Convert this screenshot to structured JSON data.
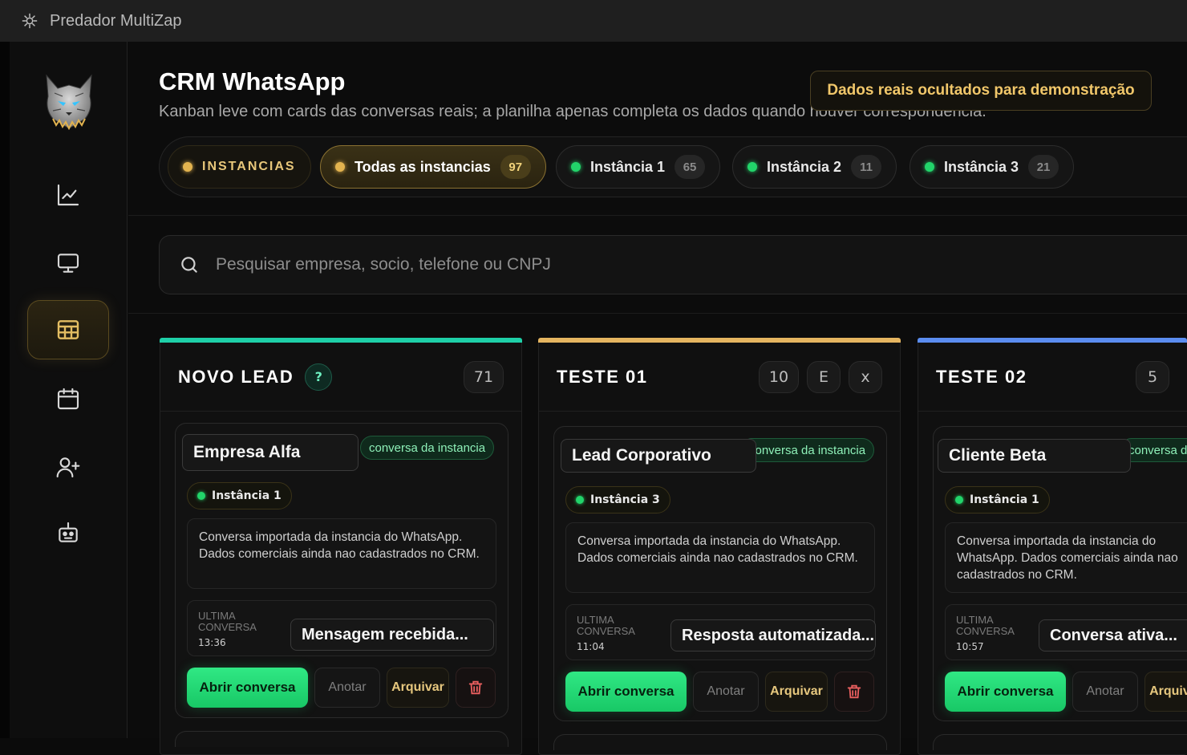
{
  "window": {
    "title": "Predador MultiZap"
  },
  "header": {
    "title": "CRM WhatsApp",
    "subtitle": "Kanban leve com cards das conversas reais; a planilha apenas completa os dados quando houver correspondência.",
    "demo_badge": "Dados reais ocultados para demonstração"
  },
  "instances": {
    "label": "INSTANCIAS",
    "chips": [
      {
        "label": "Todas as instancias",
        "count": "97"
      },
      {
        "label": "Instância 1",
        "count": "65"
      },
      {
        "label": "Instância 2",
        "count": "11"
      },
      {
        "label": "Instância 3",
        "count": "21"
      }
    ]
  },
  "search": {
    "placeholder": "Pesquisar empresa, socio, telefone ou CNPJ"
  },
  "sidebar": {
    "icons": [
      "chart-icon",
      "monitor-icon",
      "table-icon",
      "calendar-icon",
      "user-plus-icon",
      "bot-icon"
    ],
    "active": "table-icon"
  },
  "colors": {
    "accent_gold": "#e2b34f",
    "green": "#22d46a",
    "col1": "#1ed0a8",
    "col2": "#e5b560",
    "col3": "#5b8df0"
  },
  "columns": [
    {
      "title": "NOVO LEAD",
      "help": "?",
      "count": "71",
      "card": {
        "name": "Empresa Alfa",
        "tag": "conversa da instancia",
        "instance": "Instância 1",
        "description": "Conversa importada da instancia do WhatsApp. Dados comerciais ainda nao cadastrados no CRM.",
        "last_label": "ULTIMA CONVERSA",
        "last_time": "13:36",
        "last_message": "Mensagem recebida...",
        "actions": {
          "open": "Abrir conversa",
          "note": "Anotar",
          "archive": "Arquivar"
        }
      }
    },
    {
      "title": "TESTE 01",
      "count": "10",
      "edit": "E",
      "close": "x",
      "card": {
        "name": "Lead Corporativo",
        "tag": "conversa da instancia",
        "instance": "Instância 3",
        "description": "Conversa importada da instancia do WhatsApp. Dados comerciais ainda nao cadastrados no CRM.",
        "last_label": "ULTIMA CONVERSA",
        "last_time": "11:04",
        "last_message": "Resposta automatizada...",
        "actions": {
          "open": "Abrir conversa",
          "note": "Anotar",
          "archive": "Arquivar"
        }
      }
    },
    {
      "title": "TESTE 02",
      "count": "5",
      "card": {
        "name": "Cliente Beta",
        "tag": "conversa da instancia",
        "instance": "Instância 1",
        "description": "Conversa importada da instancia do WhatsApp. Dados comerciais ainda nao cadastrados no CRM.",
        "last_label": "ULTIMA CONVERSA",
        "last_time": "10:57",
        "last_message": "Conversa ativa...",
        "actions": {
          "open": "Abrir conversa",
          "note": "Anotar",
          "archive": "Arquivar"
        }
      }
    }
  ]
}
